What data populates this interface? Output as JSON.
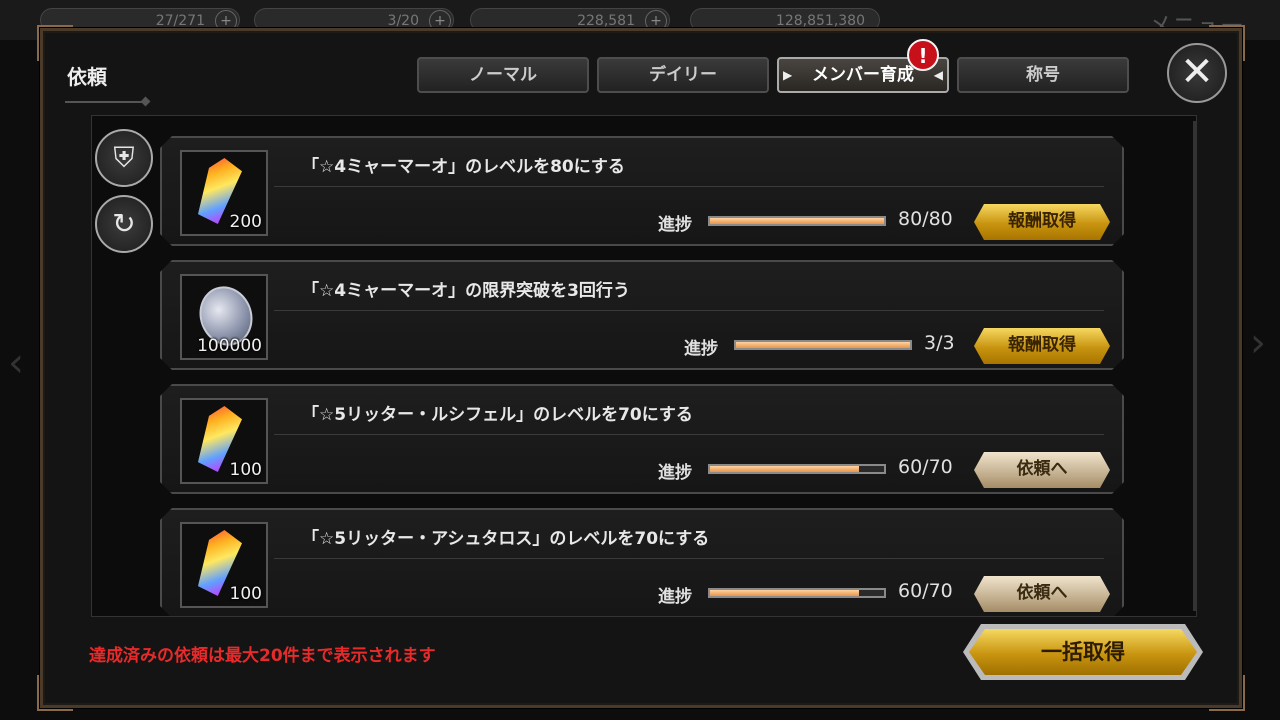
{
  "hud": {
    "ap_value": "27/271",
    "bp_value": "3/20",
    "stone_value": "228,581",
    "coin_value": "128,851,380",
    "menu_label": "メニュー"
  },
  "modal": {
    "title": "依頼",
    "tabs": [
      {
        "label": "ノーマル"
      },
      {
        "label": "デイリー"
      },
      {
        "label": "メンバー育成"
      },
      {
        "label": "称号"
      }
    ],
    "alert_badge": "!",
    "close_label": "✕"
  },
  "quests": [
    {
      "title": "「☆4ミャーマーオ」のレベルを80にする",
      "reward_qty": "200",
      "reward_icon": "rainbow-crystal-icon",
      "progress_label": "進捗",
      "progress_text": "80/80",
      "progress": 1.0,
      "button": "報酬取得",
      "button_style": "gold"
    },
    {
      "title": "「☆4ミャーマーオ」の限界突破を3回行う",
      "reward_qty": "100000",
      "reward_icon": "silver-coin-icon",
      "progress_label": "進捗",
      "progress_text": "3/3",
      "progress": 1.0,
      "button": "報酬取得",
      "button_style": "gold"
    },
    {
      "title": "「☆5リッター・ルシフェル」のレベルを70にする",
      "reward_qty": "100",
      "reward_icon": "rainbow-crystal-icon",
      "progress_label": "進捗",
      "progress_text": "60/70",
      "progress": 0.857,
      "button": "依頼へ",
      "button_style": "beige"
    },
    {
      "title": "「☆5リッター・アシュタロス」のレベルを70にする",
      "reward_qty": "100",
      "reward_icon": "rainbow-crystal-icon",
      "progress_label": "進捗",
      "progress_text": "60/70",
      "progress": 0.857,
      "button": "依頼へ",
      "button_style": "beige"
    }
  ],
  "footer": {
    "note": "達成済みの依頼は最大20件まで表示されます",
    "bulk_button": "一括取得"
  },
  "colors": {
    "accent_gold": "#d4a418",
    "note_red": "#e82a2a",
    "progress_orange": "#f0a060"
  }
}
